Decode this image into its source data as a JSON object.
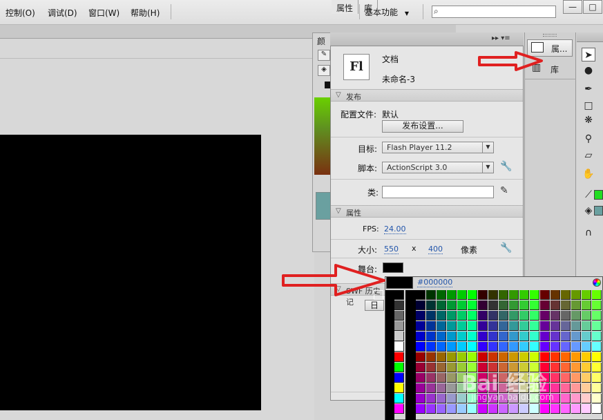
{
  "menubar": {
    "items": [
      "控制(O)",
      "调试(D)",
      "窗口(W)",
      "帮助(H)"
    ],
    "workspace": "基本功能",
    "search_placeholder": ""
  },
  "window_buttons": [
    "—",
    "□"
  ],
  "color_panel": {
    "tab": "颜"
  },
  "props_panel": {
    "tabs": [
      "属性",
      "库"
    ],
    "doc_type": "文档",
    "doc_name": "未命名-3",
    "fl_icon": "Fl",
    "publish": {
      "header": "发布",
      "profile_label": "配置文件:",
      "profile_value": "默认",
      "settings_button": "发布设置...",
      "target_label": "目标:",
      "target_value": "Flash Player 11.2",
      "script_label": "脚本:",
      "script_value": "ActionScript 3.0",
      "class_label": "类:"
    },
    "properties": {
      "header": "属性",
      "fps_label": "FPS:",
      "fps_value": "24.00",
      "size_label": "大小:",
      "width": "550",
      "x": "x",
      "height": "400",
      "unit": "像素",
      "stage_label": "舞台:"
    },
    "swf_history": {
      "header": "SWF 历史记",
      "button": "日"
    }
  },
  "dock": {
    "props_label": "属...",
    "lib_label": "库"
  },
  "picker": {
    "hex": "#000000"
  },
  "watermark": {
    "main": "Bai 经验",
    "sub": "jingyan.baidu.com"
  },
  "colors": {
    "arrow_red": "#e02020",
    "stage_color": "#000000",
    "stroke_color": "#22dd22",
    "fill_color": "#6aa0a0"
  }
}
